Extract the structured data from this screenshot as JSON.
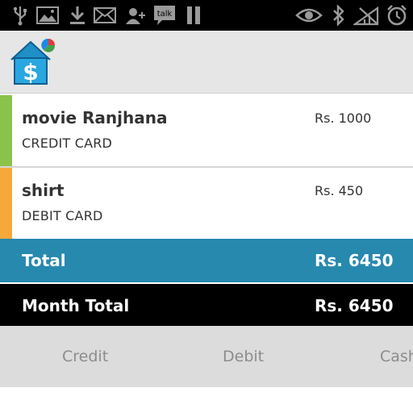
{
  "status_bar": {
    "icons": [
      "usb-icon",
      "image-icon",
      "download-icon",
      "mail-icon",
      "add-contact-icon",
      "talk-icon",
      "pause-icon",
      "eye-icon",
      "bluetooth-icon",
      "no-signal-icon",
      "alarm-icon"
    ],
    "talk_label": "talk"
  },
  "expenses": [
    {
      "name": "movie Ranjhana",
      "method": "CREDIT CARD",
      "amount": "Rs. 1000",
      "color": "#8bc34a"
    },
    {
      "name": "shirt",
      "method": "DEBIT CARD",
      "amount": "Rs. 450",
      "color": "#f5a93b"
    }
  ],
  "total": {
    "label": "Total",
    "value": "Rs. 6450"
  },
  "month_total": {
    "label": "Month Total",
    "value": "Rs. 6450"
  },
  "tabs": {
    "credit": "Credit",
    "debit": "Debit",
    "cash": "Cash"
  },
  "colors": {
    "total_bar": "#2789ae",
    "month_bar": "#000000",
    "tab_bar": "#dcdcdc"
  }
}
